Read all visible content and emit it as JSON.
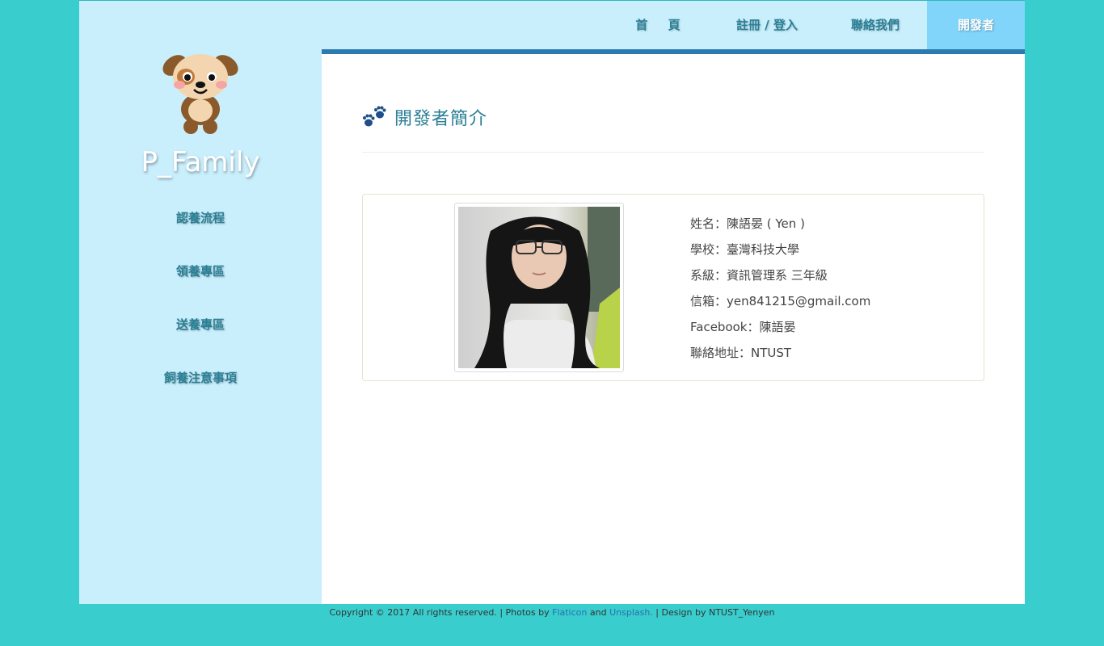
{
  "brand": {
    "name": "P_Family",
    "logo_icon": "puppy-logo-icon"
  },
  "sidebar": {
    "items": [
      {
        "label": "認養流程"
      },
      {
        "label": "領養專區"
      },
      {
        "label": "送養專區"
      },
      {
        "label": "飼養注意事項"
      }
    ]
  },
  "topnav": {
    "home": "首 頁",
    "register": "註冊 / 登入",
    "contact": "聯絡我們",
    "developer": "開發者",
    "active": "developer"
  },
  "main": {
    "heading_icon": "paw-icon",
    "title": "開發者簡介",
    "profile": {
      "photo_icon": "profile-photo",
      "name": "姓名：陳語晏 ( Yen )",
      "school": "學校：臺灣科技大學",
      "department": "系級：資訊管理系 三年級",
      "email": "信箱：yen841215@gmail.com",
      "facebook": "Facebook：陳語晏",
      "address": "聯絡地址：NTUST"
    }
  },
  "footer": {
    "prefix": "Copyright © 2017 All rights reserved. | Photos by ",
    "flaticon": "Flaticon",
    "and": " and ",
    "unsplash": "Unsplash.",
    "suffix": " | Design by NTUST_Yenyen"
  },
  "colors": {
    "background": "#3acdcd",
    "sidebar": "#c9eefc",
    "accent": "#2c7bb0",
    "active_tab": "#81d4fa",
    "nav_text": "#2a7f95"
  }
}
